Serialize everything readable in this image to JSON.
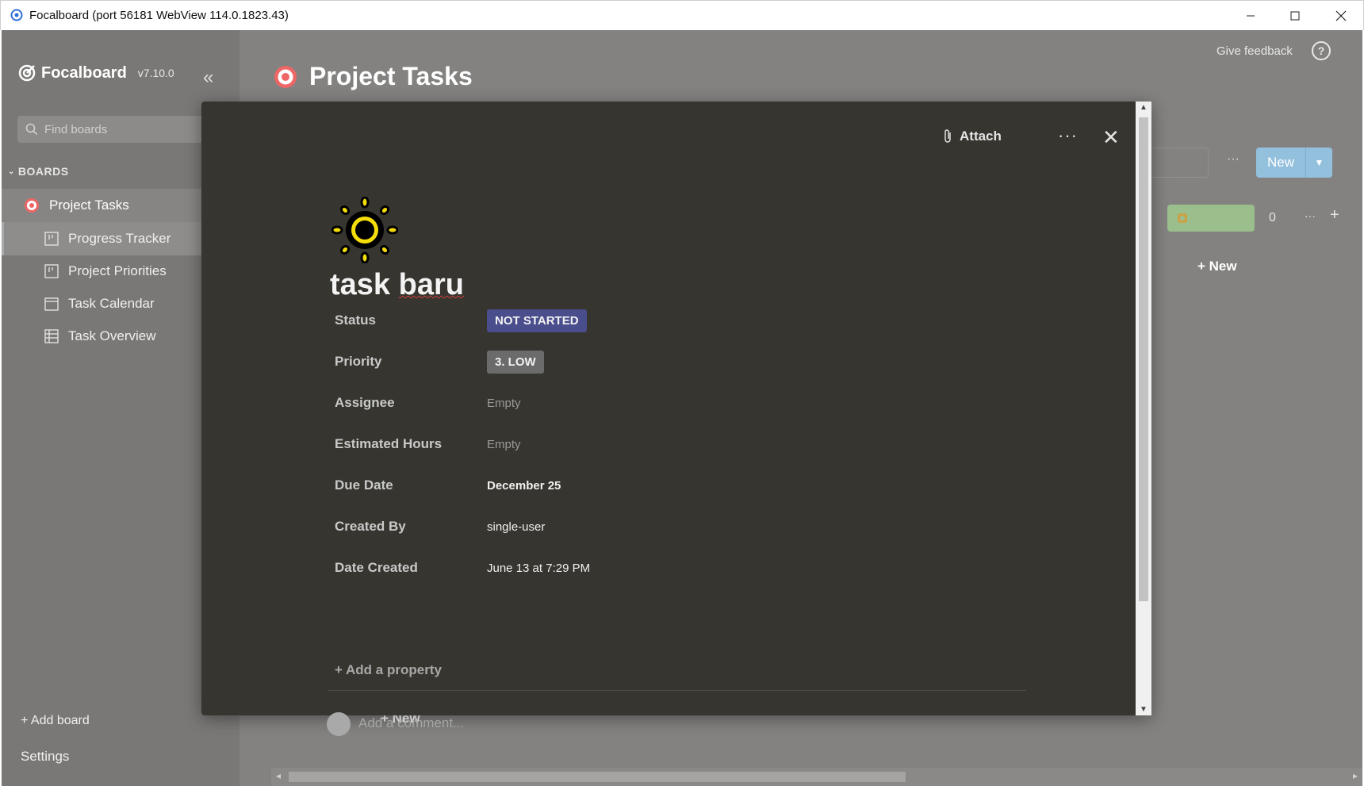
{
  "window": {
    "title": "Focalboard (port 56181 WebView 114.0.1823.43)",
    "minimize": "—",
    "maximize": "☐",
    "close": "✕"
  },
  "sidebar": {
    "brand": "Focalboard",
    "version": "v7.10.0",
    "collapse_icon": "«",
    "search_placeholder": "Find boards",
    "boards_header": "BOARDS",
    "board": {
      "label": "Project Tasks"
    },
    "views": [
      {
        "label": "Progress Tracker",
        "icon": "board-view-icon"
      },
      {
        "label": "Project Priorities",
        "icon": "board-view-icon"
      },
      {
        "label": "Task Calendar",
        "icon": "calendar-view-icon"
      },
      {
        "label": "Task Overview",
        "icon": "table-view-icon"
      }
    ],
    "add_board": "+ Add board",
    "settings": "Settings"
  },
  "header": {
    "title": "Project Tasks",
    "feedback": "Give feedback",
    "help": "?"
  },
  "board_bg": {
    "more": "···",
    "new_label": "New",
    "group_count": "0",
    "group_more": "···",
    "group_add": "+",
    "group_new": "+ New",
    "bottom_new": "+ New"
  },
  "card": {
    "attach": "Attach",
    "more": "···",
    "close": "✕",
    "title_part1": "task ",
    "title_part2": "baru",
    "properties": [
      {
        "name": "Status",
        "value": "NOT STARTED",
        "kind": "status-tag"
      },
      {
        "name": "Priority",
        "value": "3. LOW",
        "kind": "priority-tag"
      },
      {
        "name": "Assignee",
        "value": "Empty",
        "kind": "empty"
      },
      {
        "name": "Estimated Hours",
        "value": "Empty",
        "kind": "empty"
      },
      {
        "name": "Due Date",
        "value": "December 25",
        "kind": "bold"
      },
      {
        "name": "Created By",
        "value": "single-user",
        "kind": "text"
      },
      {
        "name": "Date Created",
        "value": "June 13 at 7:29 PM",
        "kind": "text"
      }
    ],
    "add_property": "+ Add a property",
    "comment_placeholder": "Add a comment..."
  },
  "colors": {
    "status_tag": "#4a4e8c",
    "priority_tag": "#6b6b6b",
    "new_button": "#93c0dd",
    "dialog_bg": "#37352f"
  }
}
